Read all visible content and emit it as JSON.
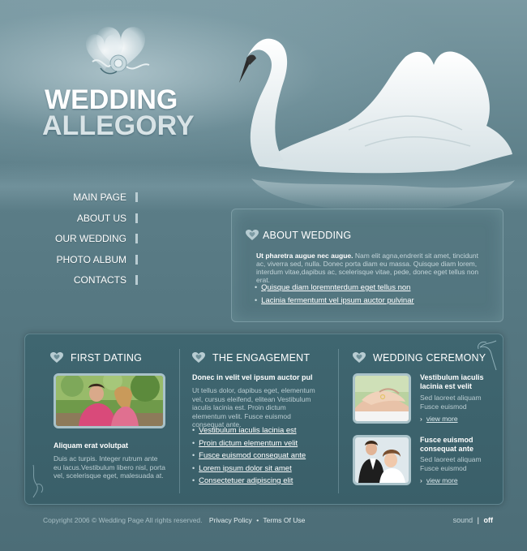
{
  "logo": {
    "line1": "WEDDING",
    "line2": "ALLEGORY"
  },
  "nav": [
    {
      "label": "MAIN PAGE"
    },
    {
      "label": "ABOUT US"
    },
    {
      "label": "OUR WEDDING"
    },
    {
      "label": "PHOTO ALBUM"
    },
    {
      "label": "CONTACTS"
    }
  ],
  "about": {
    "title": "ABOUT WEDDING",
    "lead": "Ut pharetra augue nec augue.",
    "text": "Nam elit agna,endrerit sit amet, tincidunt ac, viverra sed, nulla. Donec porta diam eu massa. Quisque diam lorem, interdum vitae,dapibus ac, scelerisque vitae, pede, donec eget tellus non erat.",
    "links": [
      "Quisque diam loremnterdum eget tellus non",
      "Lacinia fermentumt vel ipsum auctor pulvinar"
    ]
  },
  "first_dating": {
    "title": "FIRST DATING",
    "subtitle": "Aliquam erat volutpat",
    "text": "Duis ac turpis. Integer rutrum ante eu lacus.Vestibulum libero nisl, porta vel, scelerisque eget, malesuada at."
  },
  "engagement": {
    "title": "THE ENGAGEMENT",
    "subtitle": "Donec in velit vel ipsum auctor pul",
    "text": "Ut tellus dolor, dapibus eget, elementum vel, cursus eleifend, elitean Vestibulum iaculis lacinia est. Proin dictum elementum velit. Fusce euismod consequat ante.",
    "links": [
      "Vestibulum iaculis lacinia est",
      "Proin dictum elementum velit",
      "Fusce euismod consequat ante",
      "Lorem ipsum dolor sit amet",
      "Consectetuer adipiscing elit"
    ]
  },
  "ceremony": {
    "title": "WEDDING CEREMONY",
    "items": [
      {
        "title": "Vestibulum iaculis lacinia est velit",
        "text": "Sed laoreet aliquam Fusce euismod",
        "more": "view more"
      },
      {
        "title": "Fusce euismod consequat ante",
        "text": "Sed laoreet aliquam Fusce euismod",
        "more": "view more"
      }
    ]
  },
  "footer": {
    "copyright": "Copyright 2006 © Wedding Page All rights reserved.",
    "privacy": "Privacy Policy",
    "separator": "•",
    "terms": "Terms Of Use",
    "sound_label": "sound",
    "sound_sep": "|",
    "sound_state": "off"
  },
  "colors": {
    "background": "#567882",
    "panel": "#3f6670",
    "text_light": "#b9ccd1",
    "accent_white": "#ffffff"
  }
}
